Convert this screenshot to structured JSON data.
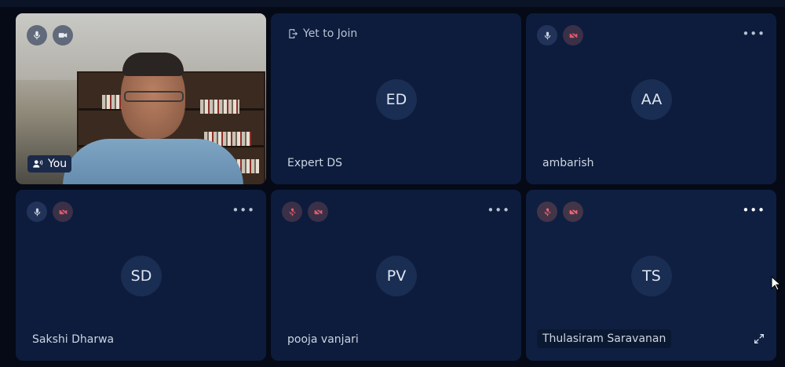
{
  "self_tile": {
    "you_label": "You"
  },
  "tiles": [
    {
      "initials": "ED",
      "name": "Expert DS",
      "status": "Yet to Join"
    },
    {
      "initials": "AA",
      "name": "ambarish"
    },
    {
      "initials": "SD",
      "name": "Sakshi Dharwa"
    },
    {
      "initials": "PV",
      "name": "pooja vanjari"
    },
    {
      "initials": "TS",
      "name": "Thulasiram Saravanan"
    }
  ],
  "colors": {
    "background": "#050a16",
    "tile": "#0d1c3c",
    "avatar": "#1a2d52",
    "muted_red": "#e05a6a"
  },
  "icons": [
    "mic-icon",
    "camera-icon",
    "mic-off-icon",
    "camera-off-icon",
    "more-options-icon",
    "expand-icon",
    "leave-door-icon",
    "speaker-person-icon"
  ]
}
